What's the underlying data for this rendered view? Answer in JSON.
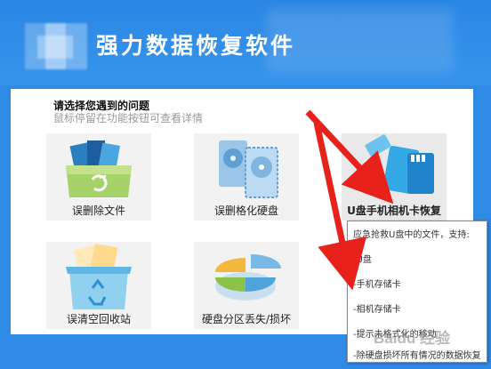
{
  "app": {
    "title": "强力数据恢复软件"
  },
  "prompt": {
    "title": "请选择您遇到的问题",
    "subtitle": "鼠标停留在功能按钮可查看详情"
  },
  "cards": [
    {
      "label": "误删除文件",
      "icon": "folder-delete-icon"
    },
    {
      "label": "误删格化硬盘",
      "icon": "hard-disk-icon"
    },
    {
      "label": "U盘手机相机卡恢复",
      "icon": "usb-sd-card-icon"
    },
    {
      "label": "误清空回收站",
      "icon": "recycle-bin-icon"
    },
    {
      "label": "硬盘分区丢失/损坏",
      "icon": "pie-partition-icon"
    }
  ],
  "tooltip": {
    "intro": "应急抢救U盘中的文件，支持:",
    "items": [
      "-U盘",
      "-手机存储卡",
      "-相机存储卡",
      "-提示未格式化的移动",
      "-除硬盘损坏所有情况的数据恢复"
    ]
  },
  "watermark": "Baidu 经验",
  "colors": {
    "header_blue": "#2f8ae6",
    "arrow_red": "#e8211b"
  }
}
